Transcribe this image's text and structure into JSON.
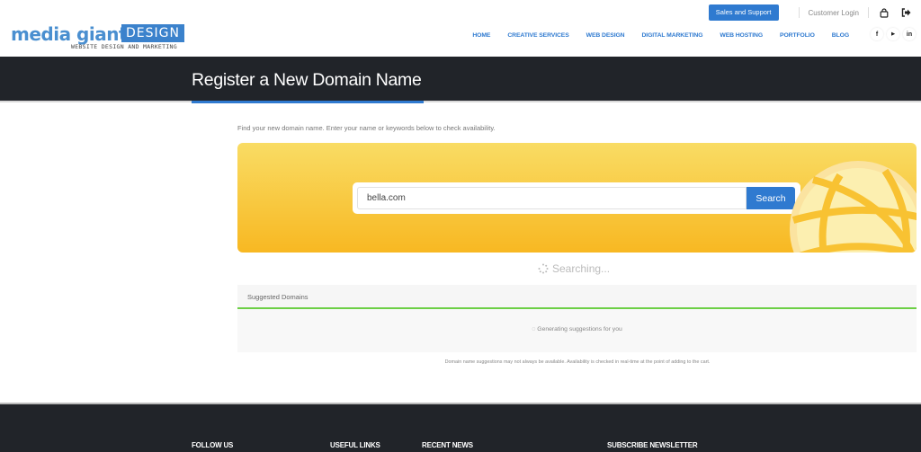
{
  "header": {
    "logo": {
      "word": "media giant",
      "badge": "DESIGN",
      "tagline": "WEBSITE DESIGN AND MARKETING"
    },
    "topbar": {
      "sales_button": "Sales and Support",
      "customer_login": "Customer Login",
      "cart_icon": "shopping-bag-icon",
      "logout_icon": "sign-out-icon"
    },
    "nav": [
      "HOME",
      "CREATIVE SERVICES",
      "WEB DESIGN",
      "DIGITAL MARKETING",
      "WEB HOSTING",
      "PORTFOLIO",
      "BLOG"
    ],
    "social": [
      {
        "icon": "facebook-icon",
        "glyph": "f"
      },
      {
        "icon": "youtube-icon",
        "glyph": "▶"
      },
      {
        "icon": "linkedin-icon",
        "glyph": "in"
      }
    ]
  },
  "page": {
    "title": "Register a New Domain Name",
    "intro": "Find your new domain name. Enter your name or keywords below to check availability."
  },
  "search": {
    "value": "bella.com",
    "button": "Search",
    "status": "Searching..."
  },
  "suggested": {
    "heading": "Suggested Domains",
    "generating": "Generating suggestions for you",
    "disclaimer": "Domain name suggestions may not always be available. Availability is checked in real-time at the point of adding to the cart."
  },
  "footer": {
    "columns": [
      "FOLLOW US",
      "USEFUL LINKS",
      "RECENT NEWS",
      "SUBSCRIBE NEWSLETTER"
    ]
  },
  "colors": {
    "brand_blue": "#2f7ad0",
    "dark_band": "#212429",
    "accent_green": "#6ccf45",
    "hero_top": "#f9dc64",
    "hero_bottom": "#f8b822"
  }
}
